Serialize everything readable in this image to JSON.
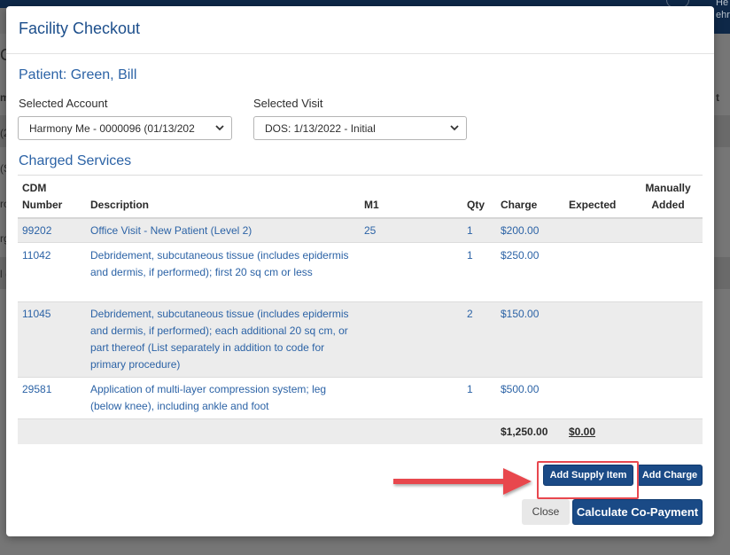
{
  "background": {
    "header_text_line1": "He",
    "header_text_line2": "ehr",
    "left_fragments": [
      "C",
      "m",
      "(2",
      "(S",
      "rov",
      "rg",
      "l ("
    ],
    "right_fragment": "t"
  },
  "modal": {
    "title": "Facility Checkout",
    "patient": "Patient: Green, Bill",
    "selected_account_label": "Selected Account",
    "selected_account_value": "Harmony Me - 0000096 (01/13/202",
    "selected_visit_label": "Selected Visit",
    "selected_visit_value": "DOS: 1/13/2022 - Initial",
    "charged_services_title": "Charged Services",
    "table": {
      "headers": {
        "cdm_line1": "CDM",
        "cdm_line2": "Number",
        "description": "Description",
        "m1": "M1",
        "qty": "Qty",
        "charge": "Charge",
        "expected": "Expected",
        "manual_line1": "Manually",
        "manual_line2": "Added"
      },
      "rows": [
        {
          "cdm": "99202",
          "description": "Office Visit - New Patient (Level 2)",
          "m1": "25",
          "qty": "1",
          "charge": "$200.00"
        },
        {
          "cdm": "11042",
          "description": "Debridement, subcutaneous tissue (includes epidermis and dermis, if performed); first 20 sq cm or less",
          "m1": "",
          "qty": "1",
          "charge": "$250.00"
        },
        {
          "cdm": "11045",
          "description": "Debridement, subcutaneous tissue (includes epidermis and dermis, if performed); each additional 20 sq cm, or part thereof (List separately in addition to code for primary procedure)",
          "m1": "",
          "qty": "2",
          "charge": "$150.00"
        },
        {
          "cdm": "29581",
          "description": "Application of multi-layer compression system; leg (below knee), including ankle and foot",
          "m1": "",
          "qty": "1",
          "charge": "$500.00"
        }
      ],
      "total_charge": "$1,250.00",
      "total_expected": "$0.00"
    },
    "buttons": {
      "add_supply_item": "Add Supply Item",
      "add_charge": "Add Charge",
      "close": "Close",
      "calculate_copayment": "Calculate Co-Payment"
    }
  },
  "colors": {
    "accent": "#1a4a86",
    "link_text": "#2c63a6",
    "highlight": "#e8474e"
  }
}
